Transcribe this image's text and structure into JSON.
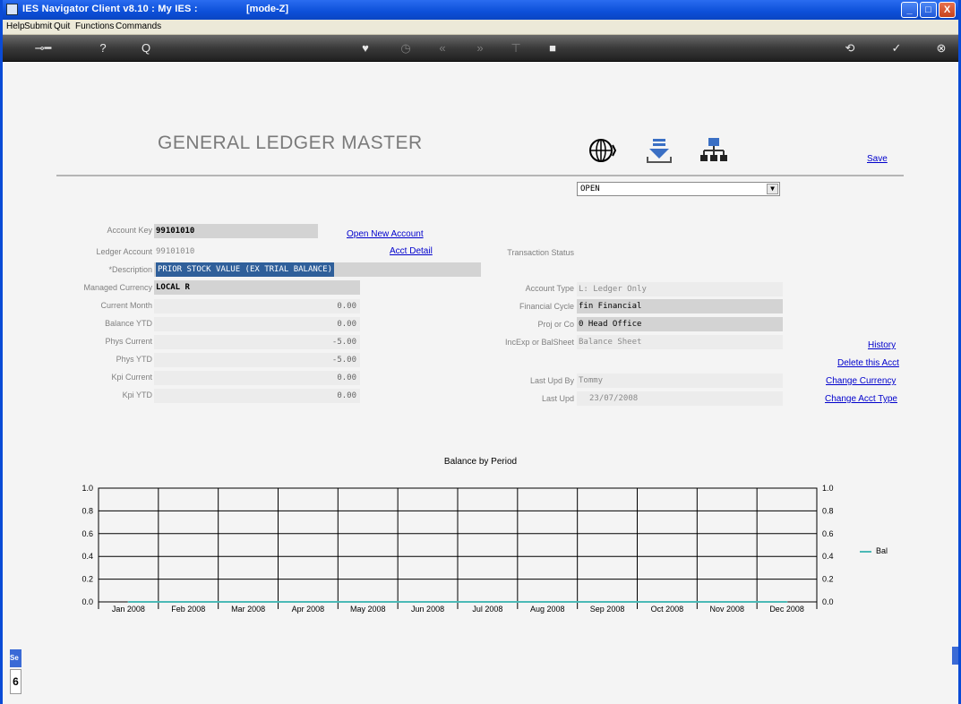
{
  "window": {
    "title": "IES Navigator Client v8.10 : My IES :",
    "mode": "[mode-Z]",
    "buttons": {
      "minimize": "_",
      "maximize": "□",
      "close": "X"
    }
  },
  "menu": [
    "Help",
    "Submit",
    "Quit",
    "Functions",
    "Commands"
  ],
  "toolbar_icons": [
    "back-key-icon",
    "help-icon",
    "search-icon",
    "heart-icon",
    "clock-icon",
    "rewind-icon",
    "forward-icon",
    "hierarchy-icon",
    "stop-icon",
    "cycle-icon",
    "check-icon",
    "close-icon"
  ],
  "page": {
    "title": "GENERAL LEDGER MASTER",
    "save_label": "Save"
  },
  "links": {
    "open_new_account": "Open New Account",
    "acct_detail": "Acct Detail",
    "history": "History",
    "delete_acct": "Delete this Acct",
    "change_currency": "Change Currency",
    "change_acct_type": "Change Acct Type"
  },
  "left_fields": {
    "account_key": {
      "label": "Account Key",
      "value": "99101010"
    },
    "ledger_account": {
      "label": "Ledger Account",
      "value": "99101010"
    },
    "description": {
      "label": "*Description",
      "value": "PRIOR STOCK VALUE (EX TRIAL BALANCE)"
    },
    "managed_currency": {
      "label": "Managed Currency",
      "value": "LOCAL R"
    },
    "current_month": {
      "label": "Current Month",
      "value": "0.00"
    },
    "balance_ytd": {
      "label": "Balance YTD",
      "value": "0.00"
    },
    "phys_current": {
      "label": "Phys Current",
      "value": "-5.00"
    },
    "phys_ytd": {
      "label": "Phys YTD",
      "value": "-5.00"
    },
    "kpi_current": {
      "label": "Kpi Current",
      "value": "0.00"
    },
    "kpi_ytd": {
      "label": "Kpi YTD",
      "value": "0.00"
    }
  },
  "right_fields": {
    "transaction_status": {
      "label": "Transaction Status",
      "value": "OPEN"
    },
    "account_type": {
      "label": "Account Type",
      "value": "L: Ledger Only"
    },
    "financial_cycle": {
      "label": "Financial Cycle",
      "value": "fin Financial"
    },
    "proj_or_co": {
      "label": "Proj or Co",
      "value": "0 Head Office"
    },
    "incexp_or_balsheet": {
      "label": "IncExp or BalSheet",
      "value": "Balance Sheet"
    },
    "last_upd_by": {
      "label": "Last Upd By",
      "value": "Tommy"
    },
    "last_upd": {
      "label": "Last Upd",
      "value": "23/07/2008"
    }
  },
  "side_stub": {
    "top": "Se",
    "bottom": "6"
  },
  "chart_data": {
    "type": "line",
    "title": "Balance by Period",
    "categories": [
      "Jan 2008",
      "Feb 2008",
      "Mar 2008",
      "Apr 2008",
      "May 2008",
      "Jun 2008",
      "Jul 2008",
      "Aug 2008",
      "Sep 2008",
      "Oct 2008",
      "Nov 2008",
      "Dec 2008"
    ],
    "series": [
      {
        "name": "Bal",
        "color": "#4bb9b6",
        "values": [
          0,
          0,
          0,
          0,
          0,
          0,
          0,
          0,
          0,
          0,
          0,
          0
        ]
      }
    ],
    "y_ticks": [
      "0.0",
      "0.2",
      "0.4",
      "0.6",
      "0.8",
      "1.0"
    ],
    "ylim": [
      0,
      1.0
    ],
    "grid": true,
    "legend": "right"
  }
}
